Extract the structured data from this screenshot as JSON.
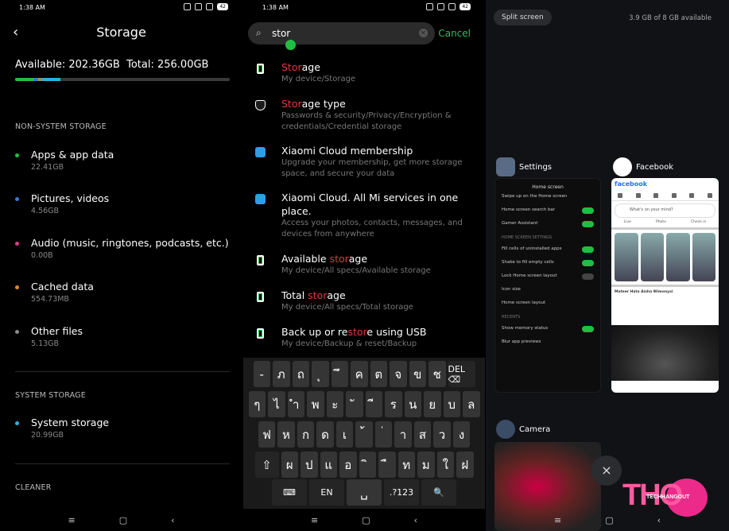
{
  "storage_screen": {
    "status_time": "1:38 AM",
    "battery": "42",
    "title": "Storage",
    "available_label": "Available: 202.36GB",
    "total_label": "Total: 256.00GB",
    "usage_segments": [
      {
        "color": "#1fbf44",
        "fraction": 0.088
      },
      {
        "color": "#3a78d6",
        "fraction": 0.018
      },
      {
        "color": "#e03a8a",
        "fraction": 0.002
      },
      {
        "color": "#e08a2a",
        "fraction": 0.002
      },
      {
        "color": "#8a8a8a",
        "fraction": 0.02
      },
      {
        "color": "#25b5d8",
        "fraction": 0.082
      }
    ],
    "non_system_header": "NON-SYSTEM STORAGE",
    "items": [
      {
        "name": "Apps & app data",
        "size": "22.41GB",
        "color": "#1fbf44"
      },
      {
        "name": "Pictures, videos",
        "size": "4.56GB",
        "color": "#3a78d6"
      },
      {
        "name": "Audio (music, ringtones, podcasts, etc.)",
        "size": "0.00B",
        "color": "#e03a8a"
      },
      {
        "name": "Cached data",
        "size": "554.73MB",
        "color": "#e08a2a"
      },
      {
        "name": "Other files",
        "size": "5.13GB",
        "color": "#8a8a8a"
      }
    ],
    "system_header": "SYSTEM STORAGE",
    "system_item": {
      "name": "System storage",
      "size": "20.99GB",
      "color": "#25b5d8"
    },
    "cleaner_header": "CLEANER",
    "nav": [
      "≡",
      "▢",
      "‹"
    ]
  },
  "search_screen": {
    "status_time": "1:38 AM",
    "battery": "42",
    "query": "stor",
    "cancel": "Cancel",
    "results": [
      {
        "pre": "",
        "hl": "Stor",
        "post": "age",
        "sub": "My device/Storage",
        "icon": "phone"
      },
      {
        "pre": "",
        "hl": "Stor",
        "post": "age type",
        "sub": "Passwords & security/Privacy/Encryption & credentials/Credential storage",
        "icon": "shield"
      },
      {
        "pre": "Xiaomi Cloud membership",
        "hl": "",
        "post": "",
        "sub": "Upgrade your membership, get more storage space, and secure your data",
        "icon": "cloud"
      },
      {
        "pre": "Xiaomi Cloud. All Mi services in one place.",
        "hl": "",
        "post": "",
        "sub": "Access your photos, contacts, messages, and devices from anywhere",
        "icon": "cloud"
      },
      {
        "pre": "Available ",
        "hl": "stor",
        "post": "age",
        "sub": "My device/All specs/Available storage",
        "icon": "phone"
      },
      {
        "pre": "Total ",
        "hl": "stor",
        "post": "age",
        "sub": "My device/All specs/Total storage",
        "icon": "phone"
      },
      {
        "pre": "Back up or re",
        "hl": "stor",
        "post": "e using USB",
        "sub": "My device/Backup & reset/Backup",
        "icon": "phone"
      }
    ],
    "keyboard": {
      "row1": [
        "-",
        "ภ",
        "ถ",
        "ุ",
        "ึ",
        "ค",
        "ต",
        "จ",
        "ข",
        "ช",
        "DEL ⌫"
      ],
      "row2": [
        "ๆ",
        "ไ",
        "ำ",
        "พ",
        "ะ",
        "ั",
        "ี",
        "ร",
        "น",
        "ย",
        "บ",
        "ล"
      ],
      "row3": [
        "ฟ",
        "ห",
        "ก",
        "ด",
        "เ",
        "้",
        "่",
        "า",
        "ส",
        "ว",
        "ง"
      ],
      "row4": [
        "⇧",
        "ผ",
        "ป",
        "แ",
        "อ",
        "ิ",
        "ื",
        "ท",
        "ม",
        "ใ",
        "ฝ"
      ],
      "row5": [
        "⌨",
        "EN",
        "␣",
        ".?123",
        "🔍"
      ]
    },
    "nav": [
      "≡",
      "▢",
      "‹"
    ]
  },
  "recents_screen": {
    "split_screen": "Split screen",
    "memory": "3.9 GB of 8 GB available",
    "settings_app": "Settings",
    "facebook_app": "Facebook",
    "camera_app": "Camera",
    "settings_preview": {
      "header": "Home screen",
      "rows": [
        {
          "label": "Swipe up on the Home screen",
          "toggle": "none"
        },
        {
          "label": "Home screen search bar",
          "toggle": "on"
        },
        {
          "label": "Gamer Assistant",
          "toggle": "on"
        },
        {
          "label": "HOME SCREEN SETTINGS",
          "toggle": "section"
        },
        {
          "label": "Fill cells of uninstalled apps",
          "toggle": "on"
        },
        {
          "label": "Shake to fill empty cells",
          "toggle": "on"
        },
        {
          "label": "Lock Home screen layout",
          "toggle": "off"
        },
        {
          "label": "Icon size",
          "toggle": "none"
        },
        {
          "label": "Home screen layout",
          "toggle": "none"
        },
        {
          "label": "RECENTS",
          "toggle": "section"
        },
        {
          "label": "Show memory status",
          "toggle": "on"
        },
        {
          "label": "Blur app previews",
          "toggle": "none"
        }
      ]
    },
    "facebook_preview": {
      "logo": "facebook",
      "mind": "What's on your mind?",
      "actions": [
        "Live",
        "Photo",
        "Check in"
      ],
      "post_author": "Mateer Hato Aisha Wimonysi"
    },
    "close_all": "×",
    "brand_big": "THO",
    "brand_small": "TECHHANGOUT",
    "nav": [
      "≡",
      "▢",
      "‹"
    ]
  }
}
